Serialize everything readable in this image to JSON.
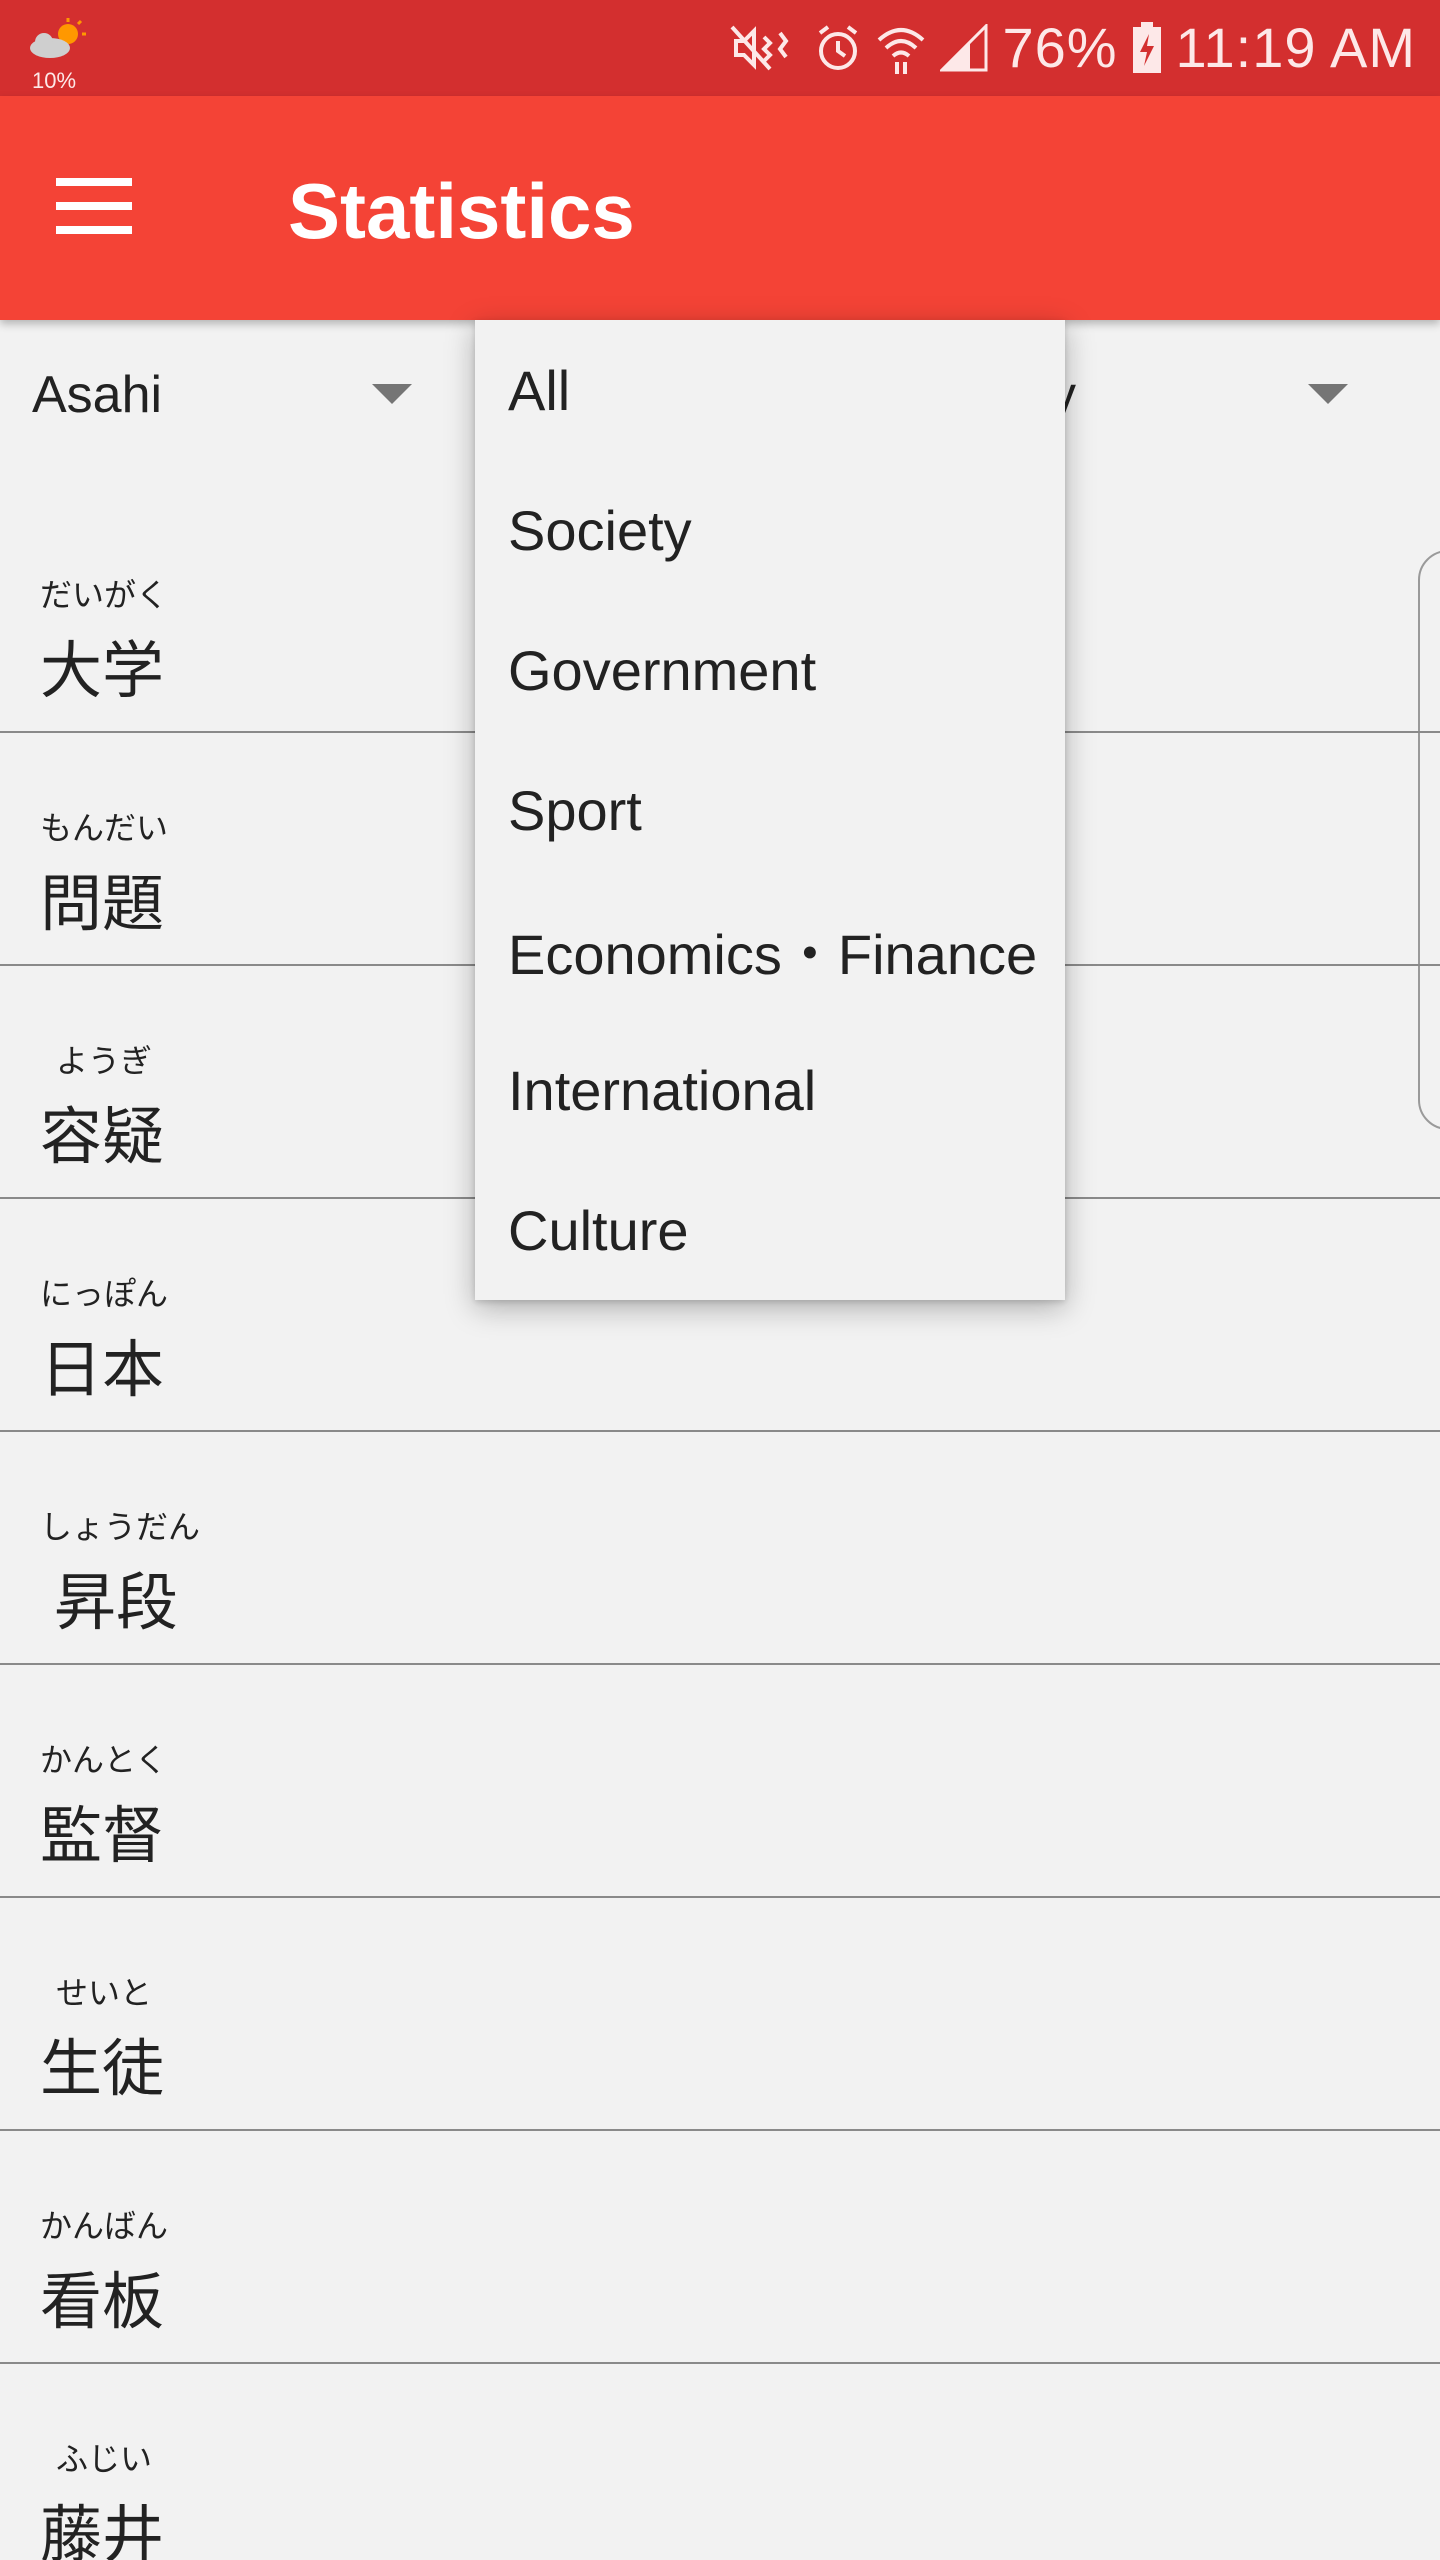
{
  "status_bar": {
    "weather_icon": "cloud-sun-icon",
    "weather_percent": "10%",
    "battery_percent": "76%",
    "time": "11:19 AM",
    "icons": [
      "mute-icon",
      "alarm-icon",
      "wifi-icon",
      "signal-icon",
      "battery-charging-icon"
    ]
  },
  "app_bar": {
    "title": "Statistics",
    "menu_icon": "hamburger-menu-icon",
    "color": "#f44336"
  },
  "spinners": {
    "source_value": "Asahi",
    "category_value_partial": "y"
  },
  "dropdown": {
    "options": [
      "All",
      "Society",
      "Government",
      "Sport",
      "Economics・Finance",
      "International",
      "Culture"
    ]
  },
  "words": [
    {
      "reading": "だいがく",
      "kanji": "大学"
    },
    {
      "reading": "もんだい",
      "kanji": "問題"
    },
    {
      "reading": "ようぎ",
      "kanji": "容疑"
    },
    {
      "reading": "にっぽん",
      "kanji": "日本"
    },
    {
      "reading": "しょうだん",
      "kanji": "昇段"
    },
    {
      "reading": "かんとく",
      "kanji": "監督"
    },
    {
      "reading": "せいと",
      "kanji": "生徒"
    },
    {
      "reading": "かんばん",
      "kanji": "看板"
    },
    {
      "reading": "ふじい",
      "kanji": "藤井"
    }
  ]
}
